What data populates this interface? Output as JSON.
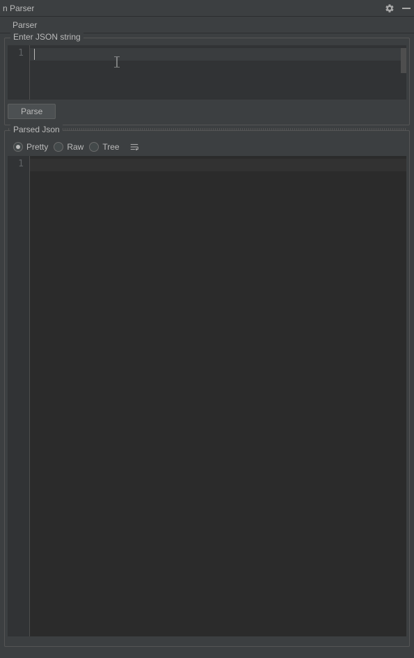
{
  "window": {
    "title": "n Parser"
  },
  "tabs": {
    "parser": "Parser"
  },
  "input": {
    "legend": "Enter JSON string",
    "line_number": "1",
    "value": "",
    "parse_button": "Parse"
  },
  "output": {
    "legend": "Parsed Json",
    "line_number": "1",
    "view_modes": {
      "pretty": "Pretty",
      "raw": "Raw",
      "tree": "Tree",
      "selected": "pretty"
    }
  }
}
